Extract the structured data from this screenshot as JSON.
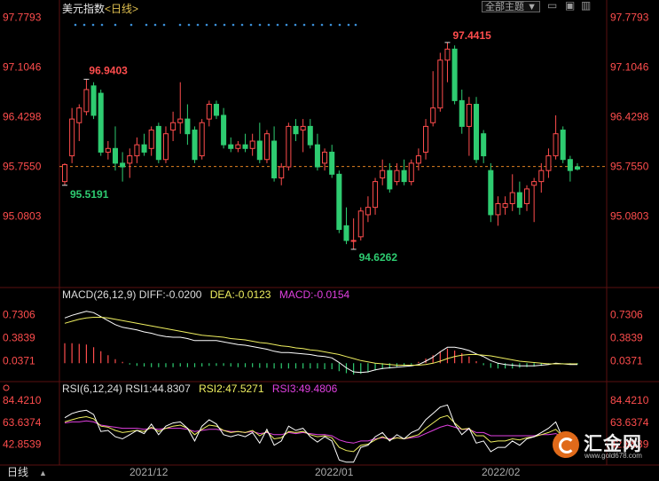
{
  "header": {
    "instrument": "美元指数",
    "period_tag": "<日线>",
    "theme_button": "全部主题",
    "theme_caret": "▼",
    "win_minimize": "▭",
    "win_restore": "▣",
    "win_close": "▥"
  },
  "colors": {
    "up": "#ff4d4d",
    "down": "#2ecc71",
    "price_axis_text": "#ff4d4d",
    "diff_line": "#ffffff",
    "dea_line": "#f0f060",
    "rsi1_line": "#ffffff",
    "rsi2_line": "#f0f060",
    "rsi3_line": "#e040e0",
    "current_price_line": "#e08020",
    "dots": "#3a8fd8"
  },
  "price_axis": {
    "ticks": [
      "97.7793",
      "97.1046",
      "96.4298",
      "95.7550",
      "95.0803"
    ],
    "high_label": "97.4415",
    "low_label": "94.6262",
    "left_high_label": "96.9403",
    "left_low_label": "95.5191"
  },
  "macd": {
    "label": "MACD(26,12,9)",
    "diff": "DIFF:-0.0200",
    "dea": "DEA:-0.0123",
    "macd": "MACD:-0.0154",
    "ticks": [
      "0.7306",
      "0.3839",
      "0.0371"
    ]
  },
  "rsi": {
    "label": "RSI(6,12,24)",
    "rsi1": "RSI1:44.8307",
    "rsi2": "RSI2:47.5271",
    "rsi3": "RSI3:49.4806",
    "ticks": [
      "84.4210",
      "63.6374",
      "42.8539"
    ]
  },
  "footer": {
    "period": "日线",
    "period_caret": "▲",
    "dates": [
      "2021/12",
      "2022/01",
      "2022/02"
    ]
  },
  "watermark": {
    "name": "汇金网",
    "url": "www.gold678.com"
  },
  "chart_data": [
    {
      "type": "candlestick",
      "title": "美元指数",
      "ylim": [
        94.4,
        97.8
      ],
      "current_price": 95.755,
      "candles": [
        {
          "o": 95.55,
          "h": 95.8,
          "l": 95.5,
          "c": 95.78
        },
        {
          "o": 95.9,
          "h": 96.55,
          "l": 95.8,
          "c": 96.4
        },
        {
          "o": 96.35,
          "h": 96.6,
          "l": 96.1,
          "c": 96.55
        },
        {
          "o": 96.5,
          "h": 96.94,
          "l": 96.45,
          "c": 96.8
        },
        {
          "o": 96.85,
          "h": 96.9,
          "l": 96.4,
          "c": 96.45
        },
        {
          "o": 96.75,
          "h": 96.8,
          "l": 95.9,
          "c": 95.95
        },
        {
          "o": 95.95,
          "h": 96.1,
          "l": 95.85,
          "c": 96.0
        },
        {
          "o": 96.0,
          "h": 96.3,
          "l": 95.7,
          "c": 95.8
        },
        {
          "o": 95.8,
          "h": 95.95,
          "l": 95.55,
          "c": 95.75
        },
        {
          "o": 95.8,
          "h": 96.0,
          "l": 95.6,
          "c": 95.9
        },
        {
          "o": 95.9,
          "h": 96.15,
          "l": 95.8,
          "c": 96.05
        },
        {
          "o": 96.05,
          "h": 96.2,
          "l": 95.9,
          "c": 95.95
        },
        {
          "o": 96.0,
          "h": 96.3,
          "l": 95.9,
          "c": 96.25
        },
        {
          "o": 96.3,
          "h": 96.35,
          "l": 95.8,
          "c": 95.85
        },
        {
          "o": 95.85,
          "h": 96.3,
          "l": 95.8,
          "c": 96.2
        },
        {
          "o": 96.25,
          "h": 96.5,
          "l": 96.1,
          "c": 96.35
        },
        {
          "o": 96.35,
          "h": 96.9,
          "l": 96.2,
          "c": 96.4
        },
        {
          "o": 96.4,
          "h": 96.6,
          "l": 96.05,
          "c": 96.2
        },
        {
          "o": 96.25,
          "h": 96.3,
          "l": 95.8,
          "c": 95.85
        },
        {
          "o": 95.9,
          "h": 96.4,
          "l": 95.85,
          "c": 96.35
        },
        {
          "o": 96.4,
          "h": 96.65,
          "l": 96.3,
          "c": 96.6
        },
        {
          "o": 96.6,
          "h": 96.65,
          "l": 96.4,
          "c": 96.45
        },
        {
          "o": 96.45,
          "h": 96.55,
          "l": 96.0,
          "c": 96.05
        },
        {
          "o": 96.05,
          "h": 96.15,
          "l": 95.95,
          "c": 96.0
        },
        {
          "o": 96.0,
          "h": 96.1,
          "l": 95.95,
          "c": 96.05
        },
        {
          "o": 96.05,
          "h": 96.2,
          "l": 95.95,
          "c": 96.0
        },
        {
          "o": 96.0,
          "h": 96.2,
          "l": 95.9,
          "c": 96.1
        },
        {
          "o": 96.1,
          "h": 96.35,
          "l": 95.8,
          "c": 95.85
        },
        {
          "o": 95.85,
          "h": 96.25,
          "l": 95.8,
          "c": 96.2
        },
        {
          "o": 96.1,
          "h": 96.3,
          "l": 95.55,
          "c": 95.6
        },
        {
          "o": 95.6,
          "h": 95.8,
          "l": 95.5,
          "c": 95.75
        },
        {
          "o": 95.75,
          "h": 96.35,
          "l": 95.7,
          "c": 96.3
        },
        {
          "o": 96.3,
          "h": 96.4,
          "l": 96.1,
          "c": 96.2
        },
        {
          "o": 96.25,
          "h": 96.4,
          "l": 95.95,
          "c": 96.3
        },
        {
          "o": 96.3,
          "h": 96.4,
          "l": 96.0,
          "c": 96.05
        },
        {
          "o": 96.05,
          "h": 96.2,
          "l": 95.7,
          "c": 95.75
        },
        {
          "o": 95.8,
          "h": 96.0,
          "l": 95.7,
          "c": 95.95
        },
        {
          "o": 95.95,
          "h": 96.05,
          "l": 95.6,
          "c": 95.65
        },
        {
          "o": 95.65,
          "h": 95.7,
          "l": 94.85,
          "c": 94.9
        },
        {
          "o": 94.95,
          "h": 95.2,
          "l": 94.7,
          "c": 94.75
        },
        {
          "o": 94.75,
          "h": 95.05,
          "l": 94.63,
          "c": 94.75
        },
        {
          "o": 94.8,
          "h": 95.2,
          "l": 94.75,
          "c": 95.15
        },
        {
          "o": 95.1,
          "h": 95.35,
          "l": 95.0,
          "c": 95.2
        },
        {
          "o": 95.2,
          "h": 95.6,
          "l": 95.1,
          "c": 95.55
        },
        {
          "o": 95.6,
          "h": 95.85,
          "l": 95.5,
          "c": 95.7
        },
        {
          "o": 95.7,
          "h": 95.8,
          "l": 95.4,
          "c": 95.45
        },
        {
          "o": 95.55,
          "h": 95.8,
          "l": 95.5,
          "c": 95.7
        },
        {
          "o": 95.7,
          "h": 95.85,
          "l": 95.5,
          "c": 95.55
        },
        {
          "o": 95.55,
          "h": 95.85,
          "l": 95.5,
          "c": 95.8
        },
        {
          "o": 95.8,
          "h": 96.0,
          "l": 95.7,
          "c": 95.9
        },
        {
          "o": 95.95,
          "h": 96.4,
          "l": 95.85,
          "c": 96.3
        },
        {
          "o": 96.35,
          "h": 97.05,
          "l": 96.3,
          "c": 96.55
        },
        {
          "o": 96.55,
          "h": 97.3,
          "l": 96.5,
          "c": 97.2
        },
        {
          "o": 97.2,
          "h": 97.44,
          "l": 96.9,
          "c": 97.35
        },
        {
          "o": 97.35,
          "h": 97.4,
          "l": 96.6,
          "c": 96.65
        },
        {
          "o": 96.65,
          "h": 96.8,
          "l": 96.2,
          "c": 96.3
        },
        {
          "o": 96.3,
          "h": 96.7,
          "l": 95.9,
          "c": 96.6
        },
        {
          "o": 96.6,
          "h": 96.7,
          "l": 95.8,
          "c": 95.85
        },
        {
          "o": 96.2,
          "h": 96.25,
          "l": 95.8,
          "c": 95.9
        },
        {
          "o": 95.7,
          "h": 95.8,
          "l": 95.0,
          "c": 95.1
        },
        {
          "o": 95.1,
          "h": 95.35,
          "l": 94.95,
          "c": 95.25
        },
        {
          "o": 95.2,
          "h": 95.35,
          "l": 95.1,
          "c": 95.25
        },
        {
          "o": 95.25,
          "h": 95.65,
          "l": 95.15,
          "c": 95.4
        },
        {
          "o": 95.4,
          "h": 95.55,
          "l": 95.1,
          "c": 95.2
        },
        {
          "o": 95.25,
          "h": 95.5,
          "l": 95.15,
          "c": 95.45
        },
        {
          "o": 95.5,
          "h": 95.6,
          "l": 95.0,
          "c": 95.55
        },
        {
          "o": 95.55,
          "h": 95.8,
          "l": 95.4,
          "c": 95.7
        },
        {
          "o": 95.7,
          "h": 96.0,
          "l": 95.6,
          "c": 95.9
        },
        {
          "o": 95.9,
          "h": 96.45,
          "l": 95.85,
          "c": 96.2
        },
        {
          "o": 96.25,
          "h": 96.3,
          "l": 95.8,
          "c": 95.85
        },
        {
          "o": 95.85,
          "h": 95.9,
          "l": 95.55,
          "c": 95.7
        },
        {
          "o": 95.75,
          "h": 95.8,
          "l": 95.7,
          "c": 95.72
        }
      ]
    },
    {
      "type": "bar+line",
      "title": "MACD(26,12,9)",
      "ylim": [
        -0.25,
        0.95
      ],
      "series": [
        {
          "name": "DIFF",
          "values": [
            0.68,
            0.72,
            0.75,
            0.78,
            0.76,
            0.7,
            0.64,
            0.58,
            0.54,
            0.52,
            0.5,
            0.47,
            0.45,
            0.42,
            0.4,
            0.39,
            0.39,
            0.37,
            0.34,
            0.34,
            0.34,
            0.34,
            0.32,
            0.3,
            0.28,
            0.27,
            0.25,
            0.23,
            0.21,
            0.18,
            0.16,
            0.16,
            0.15,
            0.14,
            0.13,
            0.11,
            0.1,
            0.08,
            0.01,
            -0.07,
            -0.13,
            -0.14,
            -0.13,
            -0.1,
            -0.08,
            -0.07,
            -0.06,
            -0.05,
            -0.04,
            -0.02,
            0.03,
            0.09,
            0.17,
            0.24,
            0.24,
            0.22,
            0.19,
            0.14,
            0.1,
            0.04,
            0.0,
            -0.02,
            -0.03,
            -0.04,
            -0.04,
            -0.04,
            -0.03,
            -0.02,
            0.0,
            -0.01,
            -0.02,
            -0.02
          ]
        },
        {
          "name": "DEA",
          "values": [
            0.6,
            0.63,
            0.66,
            0.68,
            0.69,
            0.69,
            0.68,
            0.66,
            0.64,
            0.62,
            0.6,
            0.58,
            0.56,
            0.54,
            0.52,
            0.5,
            0.48,
            0.46,
            0.44,
            0.42,
            0.41,
            0.4,
            0.39,
            0.37,
            0.36,
            0.35,
            0.33,
            0.31,
            0.3,
            0.28,
            0.26,
            0.25,
            0.23,
            0.22,
            0.2,
            0.19,
            0.17,
            0.15,
            0.13,
            0.1,
            0.07,
            0.04,
            0.02,
            0.0,
            -0.01,
            -0.02,
            -0.03,
            -0.03,
            -0.03,
            -0.03,
            -0.02,
            0.0,
            0.03,
            0.07,
            0.1,
            0.12,
            0.13,
            0.13,
            0.12,
            0.11,
            0.09,
            0.07,
            0.05,
            0.03,
            0.02,
            0.01,
            0.0,
            -0.01,
            -0.01,
            -0.01,
            -0.01,
            -0.01
          ]
        },
        {
          "name": "MACD",
          "values": [
            0.3,
            0.3,
            0.29,
            0.28,
            0.24,
            0.18,
            0.12,
            0.06,
            0.02,
            -0.02,
            -0.04,
            -0.05,
            -0.06,
            -0.06,
            -0.06,
            -0.06,
            -0.05,
            -0.06,
            -0.06,
            -0.05,
            -0.04,
            -0.04,
            -0.04,
            -0.05,
            -0.06,
            -0.06,
            -0.06,
            -0.07,
            -0.07,
            -0.08,
            -0.08,
            -0.08,
            -0.08,
            -0.08,
            -0.08,
            -0.08,
            -0.09,
            -0.09,
            -0.12,
            -0.15,
            -0.17,
            -0.16,
            -0.14,
            -0.11,
            -0.09,
            -0.08,
            -0.06,
            -0.04,
            -0.02,
            0.02,
            0.07,
            0.12,
            0.18,
            0.22,
            0.19,
            0.15,
            0.1,
            0.03,
            -0.03,
            -0.07,
            -0.08,
            -0.08,
            -0.08,
            -0.07,
            -0.06,
            -0.05,
            -0.04,
            -0.02,
            0.0,
            -0.01,
            -0.02,
            -0.02
          ]
        }
      ]
    },
    {
      "type": "line",
      "title": "RSI(6,12,24)",
      "ylim": [
        25,
        92
      ],
      "series": [
        {
          "name": "RSI1",
          "values": [
            68,
            72,
            74,
            75,
            71,
            55,
            56,
            50,
            48,
            52,
            56,
            53,
            62,
            52,
            60,
            63,
            64,
            58,
            46,
            60,
            66,
            62,
            52,
            50,
            52,
            50,
            54,
            44,
            57,
            42,
            46,
            60,
            56,
            58,
            50,
            45,
            50,
            46,
            28,
            26,
            26,
            40,
            42,
            50,
            54,
            46,
            52,
            48,
            54,
            57,
            66,
            72,
            78,
            80,
            62,
            52,
            58,
            44,
            46,
            36,
            40,
            40,
            46,
            42,
            48,
            50,
            54,
            58,
            64,
            48,
            44,
            45
          ]
        },
        {
          "name": "RSI2",
          "values": [
            64,
            66,
            68,
            69,
            67,
            60,
            59,
            56,
            54,
            55,
            56,
            55,
            59,
            55,
            58,
            60,
            61,
            58,
            52,
            57,
            61,
            60,
            56,
            54,
            55,
            54,
            56,
            51,
            55,
            48,
            49,
            55,
            54,
            55,
            52,
            50,
            51,
            49,
            40,
            37,
            36,
            42,
            43,
            47,
            50,
            47,
            49,
            48,
            50,
            52,
            58,
            63,
            68,
            70,
            63,
            57,
            58,
            51,
            51,
            45,
            46,
            46,
            48,
            47,
            49,
            50,
            52,
            54,
            57,
            50,
            48,
            48
          ]
        },
        {
          "name": "RSI3",
          "values": [
            63,
            64,
            64,
            65,
            64,
            61,
            60,
            59,
            58,
            58,
            58,
            57,
            58,
            57,
            58,
            58,
            58,
            57,
            55,
            56,
            57,
            57,
            56,
            55,
            55,
            54,
            55,
            53,
            54,
            52,
            52,
            54,
            53,
            54,
            53,
            52,
            52,
            51,
            47,
            45,
            44,
            46,
            46,
            48,
            49,
            48,
            49,
            48,
            49,
            50,
            53,
            56,
            59,
            61,
            59,
            57,
            57,
            54,
            54,
            51,
            51,
            51,
            51,
            51,
            51,
            51,
            52,
            52,
            53,
            50,
            49,
            49
          ]
        }
      ]
    }
  ]
}
